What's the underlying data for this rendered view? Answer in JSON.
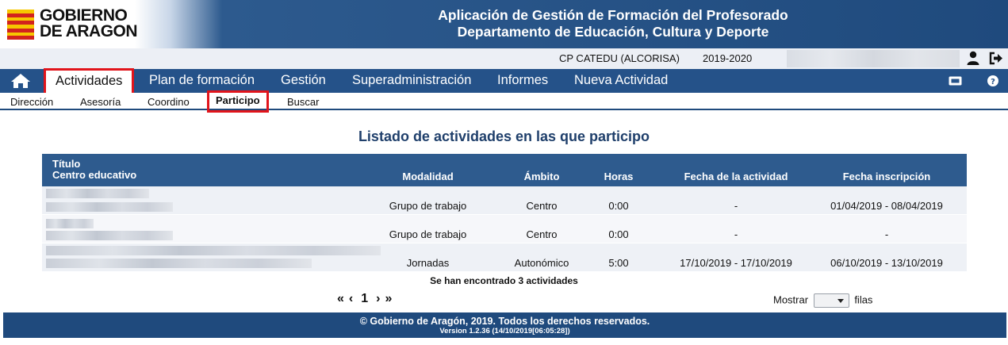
{
  "header": {
    "logo_line1": "GOBIERNO",
    "logo_line2": "DE ARAGON",
    "title_line1": "Aplicación de Gestión de Formación del Profesorado",
    "title_line2": "Departamento de Educación, Cultura y Deporte"
  },
  "infobar": {
    "center": "CP CATEDU (ALCORISA)",
    "year": "2019-2020"
  },
  "nav": {
    "items": [
      "Actividades",
      "Plan de formación",
      "Gestión",
      "Superadministración",
      "Informes",
      "Nueva Actividad"
    ],
    "active": "Actividades"
  },
  "subnav": {
    "items": [
      "Dirección",
      "Asesoría",
      "Coordino",
      "Participo",
      "Buscar"
    ],
    "active": "Participo"
  },
  "page_title": "Listado de actividades en las que participo",
  "table": {
    "header_title_1": "Título",
    "header_title_2": "Centro educativo",
    "columns": [
      "Modalidad",
      "Ámbito",
      "Horas",
      "Fecha de la actividad",
      "Fecha inscripción"
    ],
    "rows": [
      {
        "modalidad": "Grupo de trabajo",
        "ambito": "Centro",
        "horas": "0:00",
        "fecha_actividad": "-",
        "fecha_inscripcion": "01/04/2019 - 08/04/2019"
      },
      {
        "modalidad": "Grupo de trabajo",
        "ambito": "Centro",
        "horas": "0:00",
        "fecha_actividad": "-",
        "fecha_inscripcion": "-"
      },
      {
        "modalidad": "Jornadas",
        "ambito": "Autonómico",
        "horas": "5:00",
        "fecha_actividad": "17/10/2019 - 17/10/2019",
        "fecha_inscripcion": "06/10/2019 - 13/10/2019"
      }
    ]
  },
  "found_text": "Se han encontrado 3 actividades",
  "pager": {
    "first": "«",
    "prev": "‹",
    "page": "1",
    "next": "›",
    "last": "»"
  },
  "show_rows": {
    "label_before": "Mostrar",
    "label_after": "filas"
  },
  "footer": {
    "line1": "© Gobierno de Aragón, 2019. Todos los derechos reservados.",
    "line2": "Version 1.2.36 (14/10/2019[06:05:28])"
  },
  "icons": {
    "home": "home-icon",
    "user": "user-icon",
    "logout": "logout-icon",
    "ticket": "ticket-icon",
    "help": "help-icon"
  },
  "colors": {
    "brand": "#255289",
    "highlight": "#e1141b",
    "title": "#1f3f6b"
  }
}
